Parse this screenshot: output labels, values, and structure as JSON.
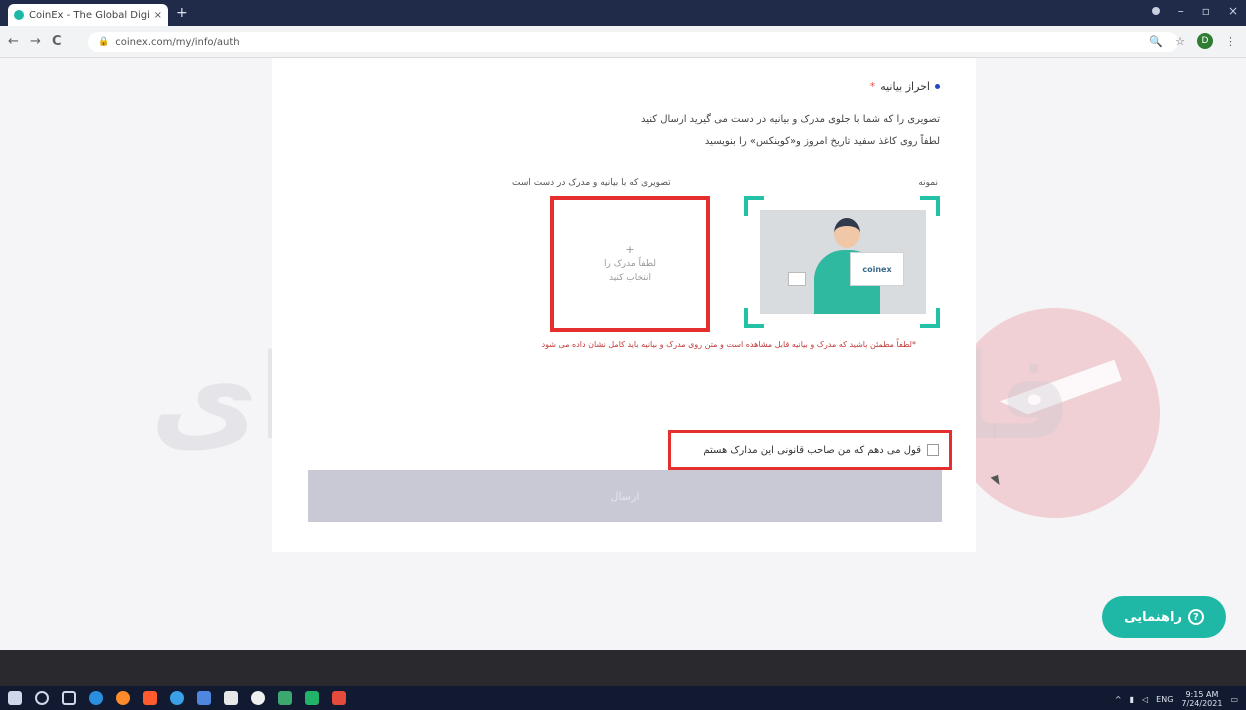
{
  "browser": {
    "tab_title": "CoinEx - The Global Digital Coin",
    "tab_close": "×",
    "new_tab": "+",
    "url": "coinex.com/my/info/auth",
    "back": "←",
    "forward": "→",
    "reload": "C",
    "profile_initial": "D"
  },
  "verification": {
    "title": "احراز بیانیه",
    "required_mark": "*",
    "instruction_1": "تصویری را که شما با جلوی مدرک و بیانیه در دست می گیرید ارسال کنید",
    "instruction_2": "لطفاً روی کاغذ سفید تاریخ امروز و«کوینکس» را بنویسید",
    "sample_label": "نمونه",
    "upload_label": "تصویری که با بیانیه و مدرک در دست است",
    "sample_brand": "coinex",
    "upload_plus": "+",
    "upload_text": "لطفاً مدرک را انتخاب کنید",
    "warning": "*لطفاً مطمئن باشید که مدرک و بیانیه قابل مشاهده است و متن روی مدرک و بیانیه باید کامل نشان داده می شود",
    "agree_text": "قول می دهم که من صاحب قانونی این مدارک هستم",
    "submit_label": "ارسال"
  },
  "watermark": {
    "text": "فارسی حرفه‌ای"
  },
  "help": {
    "label": "راهنمایی",
    "icon_glyph": "?"
  },
  "taskbar": {
    "time": "9:15 AM",
    "date": "7/24/2021",
    "lang": "ENG"
  },
  "colors": {
    "accent": "#1fb8a6",
    "highlight_red": "#e52e2e",
    "submit_disabled": "#c9c9d6",
    "titlebar": "#202b4a"
  },
  "icons": {
    "taskbar_apps": [
      "windows-start-icon",
      "search-icon",
      "task-view-icon",
      "edge-icon",
      "firefox-icon",
      "app-icon-1",
      "app-icon-2",
      "app-icon-3",
      "store-icon",
      "chrome-icon",
      "app-icon-4",
      "app-icon-5",
      "app-icon-6"
    ]
  }
}
